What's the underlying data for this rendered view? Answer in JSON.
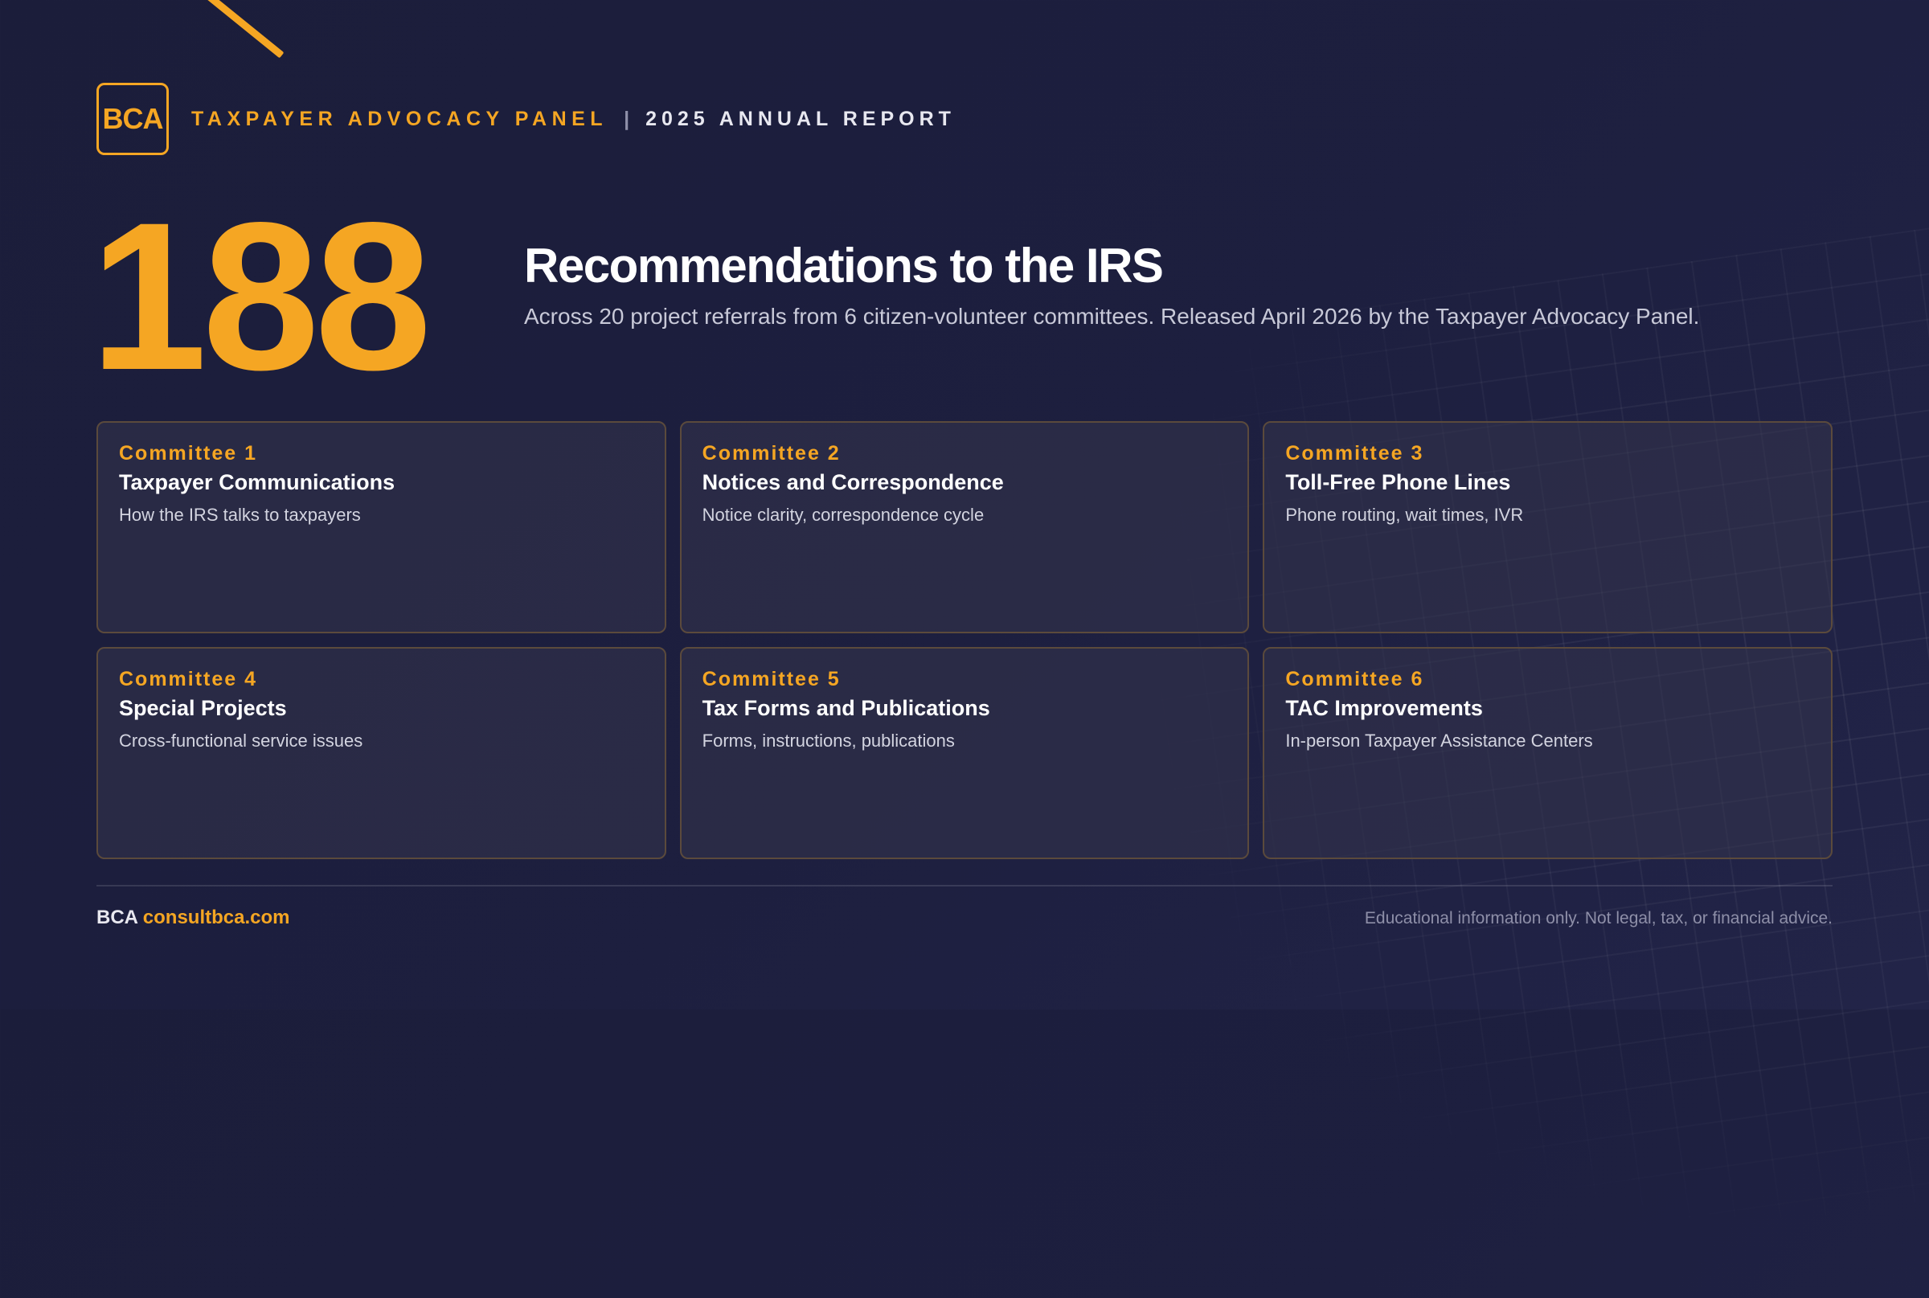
{
  "header": {
    "logo_text": "BCA",
    "org": "TAXPAYER ADVOCACY PANEL",
    "separator": "|",
    "report": "2025 ANNUAL REPORT"
  },
  "hero": {
    "number": "188",
    "headline": "Recommendations to the IRS",
    "subline": "Across 20 project referrals from 6 citizen-volunteer committees. Released April 2026 by the Taxpayer Advocacy Panel."
  },
  "committees": [
    {
      "number": "Committee 1",
      "title": "Taxpayer Communications",
      "desc": "How the IRS talks to taxpayers"
    },
    {
      "number": "Committee 2",
      "title": "Notices and Correspondence",
      "desc": "Notice clarity, correspondence cycle"
    },
    {
      "number": "Committee 3",
      "title": "Toll-Free Phone Lines",
      "desc": "Phone routing, wait times, IVR"
    },
    {
      "number": "Committee 4",
      "title": "Special Projects",
      "desc": "Cross-functional service issues"
    },
    {
      "number": "Committee 5",
      "title": "Tax Forms and Publications",
      "desc": "Forms, instructions, publications"
    },
    {
      "number": "Committee 6",
      "title": "TAC Improvements",
      "desc": "In-person Taxpayer Assistance Centers"
    }
  ],
  "footer": {
    "brand": "BCA",
    "url": "consultbca.com",
    "disclaimer": "Educational information only. Not legal, tax, or financial advice."
  },
  "colors": {
    "accent": "#f5a623",
    "background": "#1b1d3a",
    "card_border": "#5b4a3c"
  }
}
